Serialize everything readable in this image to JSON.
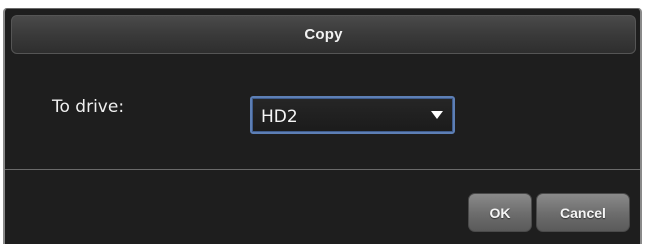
{
  "dialog": {
    "title": "Copy",
    "to_drive": {
      "label": "To drive:",
      "selected": "HD2"
    },
    "buttons": {
      "ok": "OK",
      "cancel": "Cancel"
    }
  },
  "icons": {
    "dropdown": "caret-down-icon"
  },
  "colors": {
    "background": "#1e1e1e",
    "focus_border": "#5d7fb5",
    "button": "#6c6c6c"
  }
}
